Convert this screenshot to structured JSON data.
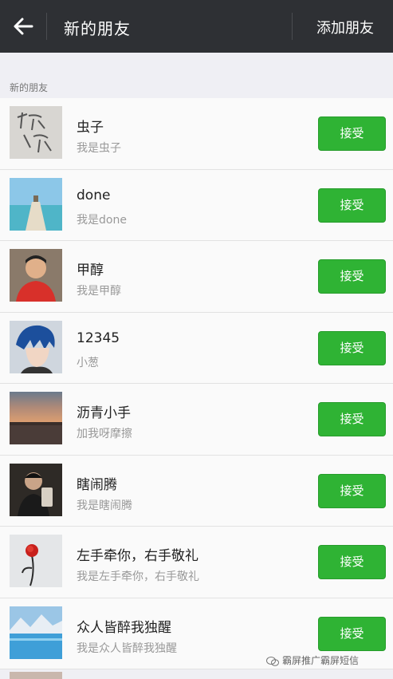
{
  "header": {
    "title": "新的朋友",
    "add_label": "添加朋友"
  },
  "section": {
    "label": "新的朋友"
  },
  "accept_label": "接受",
  "rows": [
    {
      "name": "虫子",
      "message": "我是虫子",
      "avatar": "handwriting"
    },
    {
      "name": "done",
      "message": "我是done",
      "avatar": "pier-sea"
    },
    {
      "name": "甲醇",
      "message": "我是甲醇",
      "avatar": "person-red"
    },
    {
      "name": "12345",
      "message": "小葱",
      "avatar": "anime-blue-hair"
    },
    {
      "name": "沥青小手",
      "message": "加我呀摩擦",
      "avatar": "sunset"
    },
    {
      "name": "瞎闹腾",
      "message": "我是瞎闹腾",
      "avatar": "person-dark"
    },
    {
      "name": "左手牵你，右手敬礼",
      "message": "我是左手牵你，右手敬礼",
      "avatar": "red-rose"
    },
    {
      "name": "众人皆醉我独醒",
      "message": "我是众人皆醉我独醒",
      "avatar": "mountain-lake"
    }
  ],
  "watermark": {
    "text": "霸屏推广霸屏短信",
    "icon": "wechat-icon"
  },
  "colors": {
    "header_bg": "#2e3034",
    "accept_green": "#2fb334",
    "page_bg": "#efeff4"
  }
}
